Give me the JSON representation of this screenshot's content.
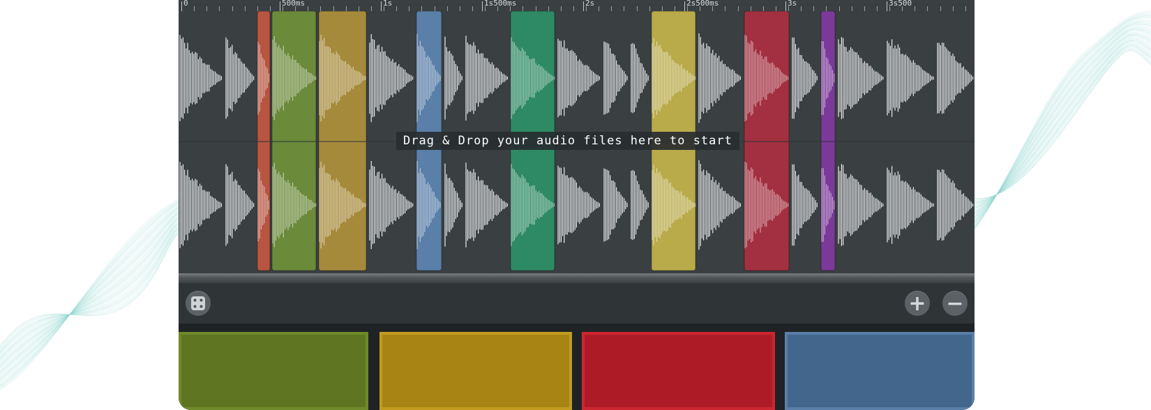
{
  "ruler": {
    "ticks": [
      "0",
      "500ms",
      "1s",
      "1s500ms",
      "2s",
      "2s500ms",
      "3s",
      "3s500"
    ]
  },
  "drop_hint": "Drag & Drop your audio files here to start",
  "toolbar": {
    "random_icon": "dice-icon",
    "zoom_in_symbol": "+",
    "zoom_out_symbol": "−",
    "zoom_in_icon": "plus-icon",
    "zoom_out_icon": "minus-icon"
  },
  "colors": {
    "app_bg": "#2b3033",
    "lane_bg": "#3a3f42",
    "waveform": "#e8eaeb",
    "background_waves": "#8fd6cf"
  },
  "segments": [
    {
      "color": "#b85540"
    },
    {
      "color": "#6b8a3a"
    },
    {
      "color": "#a68a3c"
    },
    {
      "color": "#5a7fa8"
    },
    {
      "color": "#2e8a64"
    },
    {
      "color": "#b9aa4a"
    },
    {
      "color": "#a33040"
    },
    {
      "color": "#7b3a9a"
    }
  ],
  "pads": [
    {
      "name": "pad-green",
      "fill": "#5f7522",
      "border": "#6f8a2a"
    },
    {
      "name": "pad-yellow",
      "fill": "#a88414",
      "border": "#c39b1f"
    },
    {
      "name": "pad-red",
      "fill": "#ad1c26",
      "border": "#cc2630"
    },
    {
      "name": "pad-blue",
      "fill": "#43668d",
      "border": "#5a7fa8"
    }
  ]
}
